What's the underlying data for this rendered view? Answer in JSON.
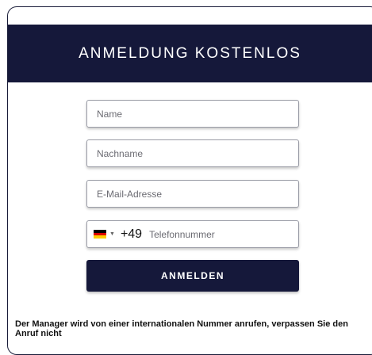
{
  "header": {
    "title": "ANMELDUNG KOSTENLOS"
  },
  "form": {
    "name_placeholder": "Name",
    "lastname_placeholder": "Nachname",
    "email_placeholder": "E-Mail-Adresse",
    "phone": {
      "country_flag": "germany-flag-icon",
      "dial_code": "+49",
      "placeholder": "Telefonnummer"
    },
    "submit_label": "ANMELDEN"
  },
  "note": "Der Manager wird von einer internationalen Nummer anrufen, verpassen Sie den Anruf nicht",
  "colors": {
    "primary": "#15183a",
    "flag_black": "#000000",
    "flag_red": "#dd0000",
    "flag_gold": "#ffce00"
  }
}
